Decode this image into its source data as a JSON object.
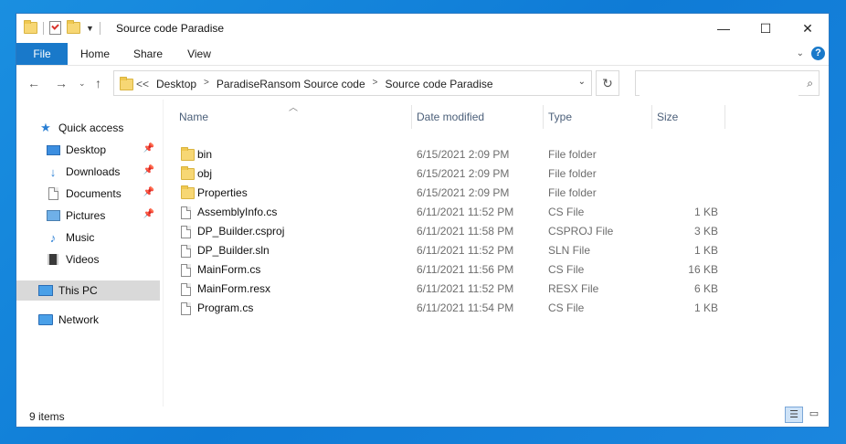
{
  "window": {
    "title": "Source code Paradise",
    "controls": {
      "minimize": "—",
      "maximize": "☐",
      "close": "✕"
    }
  },
  "ribbon": {
    "tabs": [
      "File",
      "Home",
      "Share",
      "View"
    ],
    "help": "?"
  },
  "address": {
    "overflow": "<<",
    "breadcrumbs": [
      "Desktop",
      "ParadiseRansom Source code",
      "Source code Paradise"
    ],
    "search_placeholder": ""
  },
  "sidebar": {
    "items": [
      {
        "label": "Quick access",
        "icon": "star-icon",
        "pinned": false
      },
      {
        "label": "Desktop",
        "icon": "desktop-icon",
        "pinned": true
      },
      {
        "label": "Downloads",
        "icon": "download-icon",
        "pinned": true
      },
      {
        "label": "Documents",
        "icon": "document-icon",
        "pinned": true
      },
      {
        "label": "Pictures",
        "icon": "picture-icon",
        "pinned": true
      },
      {
        "label": "Music",
        "icon": "music-icon",
        "pinned": false
      },
      {
        "label": "Videos",
        "icon": "video-icon",
        "pinned": false
      },
      {
        "label": "This PC",
        "icon": "computer-icon",
        "selected": true
      },
      {
        "label": "Network",
        "icon": "network-icon",
        "pinned": false
      }
    ]
  },
  "columns": {
    "name": "Name",
    "date": "Date modified",
    "type": "Type",
    "size": "Size"
  },
  "files": [
    {
      "name": "bin",
      "date": "6/15/2021 2:09 PM",
      "type": "File folder",
      "size": "",
      "kind": "folder"
    },
    {
      "name": "obj",
      "date": "6/15/2021 2:09 PM",
      "type": "File folder",
      "size": "",
      "kind": "folder"
    },
    {
      "name": "Properties",
      "date": "6/15/2021 2:09 PM",
      "type": "File folder",
      "size": "",
      "kind": "folder"
    },
    {
      "name": "AssemblyInfo.cs",
      "date": "6/11/2021 11:52 PM",
      "type": "CS File",
      "size": "1 KB",
      "kind": "file"
    },
    {
      "name": "DP_Builder.csproj",
      "date": "6/11/2021 11:58 PM",
      "type": "CSPROJ File",
      "size": "3 KB",
      "kind": "file"
    },
    {
      "name": "DP_Builder.sln",
      "date": "6/11/2021 11:52 PM",
      "type": "SLN File",
      "size": "1 KB",
      "kind": "file"
    },
    {
      "name": "MainForm.cs",
      "date": "6/11/2021 11:56 PM",
      "type": "CS File",
      "size": "16 KB",
      "kind": "file"
    },
    {
      "name": "MainForm.resx",
      "date": "6/11/2021 11:52 PM",
      "type": "RESX File",
      "size": "6 KB",
      "kind": "file"
    },
    {
      "name": "Program.cs",
      "date": "6/11/2021 11:54 PM",
      "type": "CS File",
      "size": "1 KB",
      "kind": "file"
    }
  ],
  "status": {
    "item_count": "9 items"
  },
  "colors": {
    "accent": "#1979ca",
    "selected": "#d9d9d9",
    "folder": "#f7d774"
  }
}
